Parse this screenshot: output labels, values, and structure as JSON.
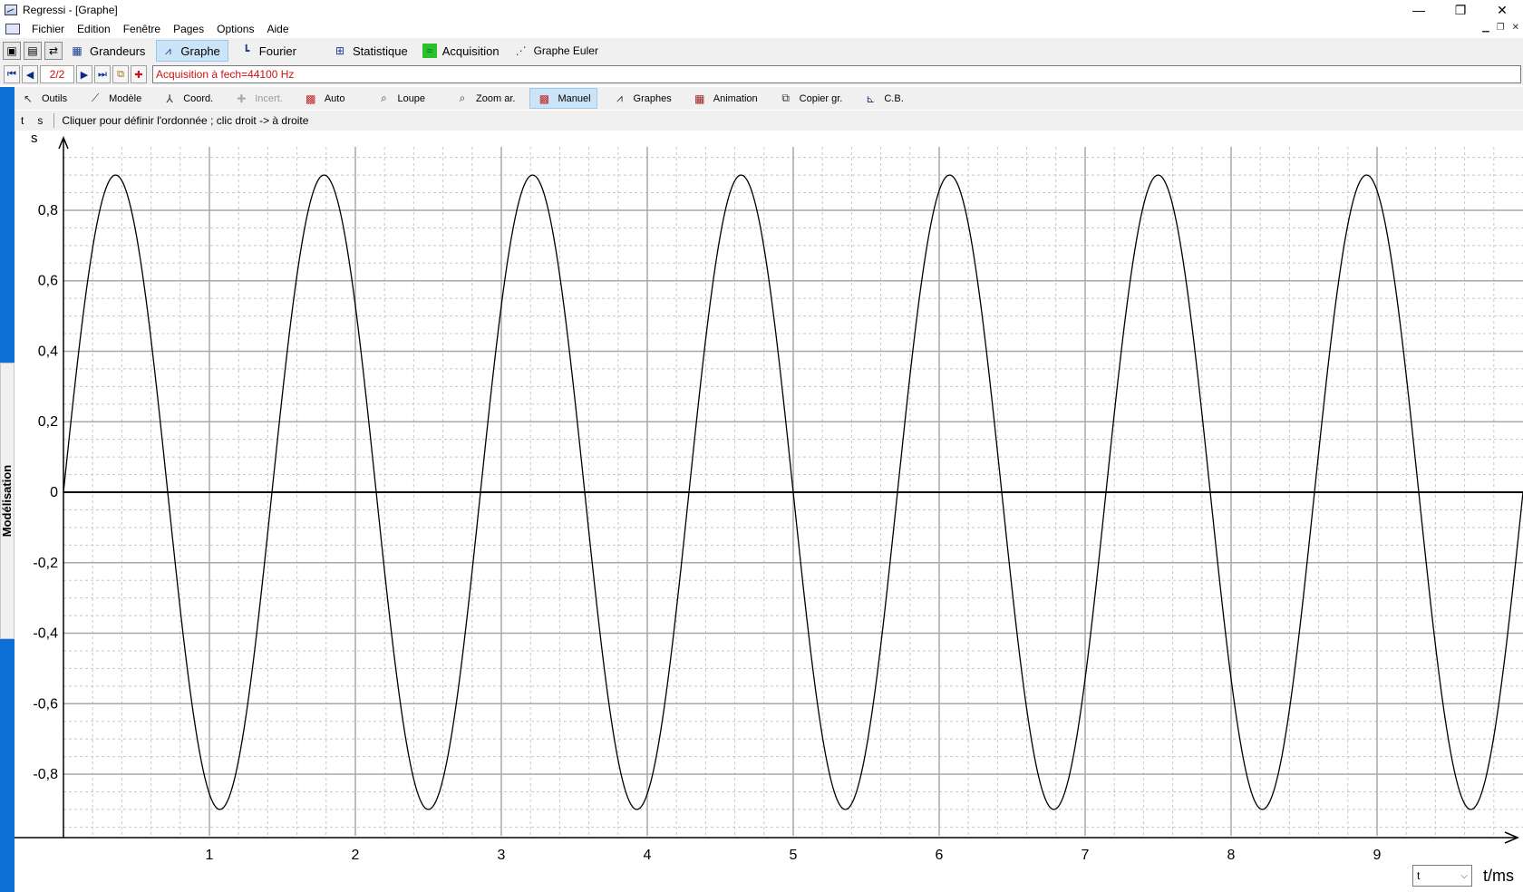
{
  "window": {
    "title": "Regressi - [Graphe]",
    "minimize": "—",
    "restore": "❐",
    "close": "✕"
  },
  "menu": {
    "items": [
      "Fichier",
      "Edition",
      "Fenêtre",
      "Pages",
      "Options",
      "Aide"
    ]
  },
  "tabs": [
    {
      "label": "Grandeurs",
      "icon": "table-icon"
    },
    {
      "label": "Graphe",
      "icon": "graph-icon",
      "active": true
    },
    {
      "label": "Fourier",
      "icon": "spectrum-icon"
    },
    {
      "label": "Statistique",
      "icon": "statistics-icon"
    },
    {
      "label": "Acquisition",
      "icon": "acquisition-icon"
    },
    {
      "label": "Graphe Euler",
      "icon": "euler-graph-icon"
    }
  ],
  "pagebar": {
    "page": "2/2",
    "acquisition_label": "Acquisition à fech=44100 Hz"
  },
  "tools": [
    {
      "label": "Outils",
      "icon": "pointer-icon"
    },
    {
      "label": "Modèle",
      "icon": "model-icon"
    },
    {
      "label": "Coord.",
      "icon": "coordinates-icon"
    },
    {
      "label": "Incert.",
      "icon": "uncertainty-icon",
      "disabled": true
    },
    {
      "label": "Auto",
      "icon": "auto-scale-icon"
    },
    {
      "label": "Loupe",
      "icon": "magnifier-icon"
    },
    {
      "label": "Zoom ar.",
      "icon": "zoom-out-icon"
    },
    {
      "label": "Manuel",
      "icon": "manual-scale-icon",
      "active": true
    },
    {
      "label": "Graphes",
      "icon": "graphs-icon"
    },
    {
      "label": "Animation",
      "icon": "animation-icon"
    },
    {
      "label": "Copier gr.",
      "icon": "copy-graph-icon"
    },
    {
      "label": "C.B.",
      "icon": "cb-icon"
    }
  ],
  "infobar": {
    "var_t": "t",
    "var_s": "s",
    "hint": "Cliquer pour définir l'ordonnée ; clic droit -> à droite"
  },
  "sidepanel": {
    "label": "Modélisation"
  },
  "chart_data": {
    "type": "line",
    "ylabel": "s",
    "xlabel": "t/ms",
    "xlim": [
      0,
      10
    ],
    "ylim": [
      -0.98,
      0.98
    ],
    "x_ticks": [
      1,
      2,
      3,
      4,
      5,
      6,
      7,
      8,
      9
    ],
    "y_ticks": [
      0.8,
      0.6,
      0.4,
      0.2,
      0,
      -0.2,
      -0.4,
      -0.6,
      -0.8
    ],
    "y_tick_labels": [
      "0,8",
      "0,6",
      "0,4",
      "0,2",
      "0",
      "-0,2",
      "-0,4",
      "-0,6",
      "-0,8"
    ],
    "series": [
      {
        "function": "sinusoid",
        "amplitude": 0.9,
        "frequency_khz": 0.7,
        "phase": 0,
        "color": "#000000"
      }
    ],
    "grid": true
  },
  "x_axis_select": {
    "value": "t",
    "unit_label": "t/ms"
  },
  "colors": {
    "accent": "#0f6fd8",
    "active_tab": "#cce4f7",
    "red_text": "#d01010"
  }
}
